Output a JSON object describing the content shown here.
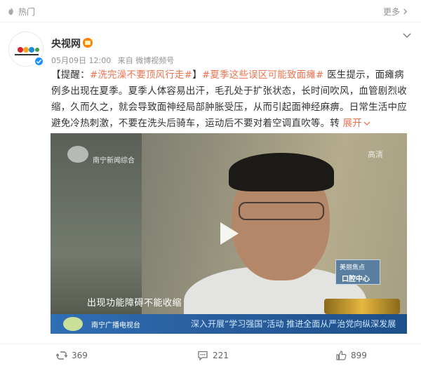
{
  "topbar": {
    "hot_label": "热门",
    "more_label": "更多"
  },
  "post": {
    "author": "央视网",
    "date": "05月09日 12:00",
    "source": "来自 微博视频号",
    "content": {
      "prefix": "【提醒：",
      "tag1": "#洗完澡不要顶风行走#",
      "mid": "】",
      "tag2": "#夏季这些误区可能致面瘫#",
      "body": " 医生提示，面瘫病例多出现在夏季。夏季人体容易出汗，毛孔处于扩张状态，长时间吹风，血管剧烈收缩，久而久之，就会导致面神经局部肿胀受压，从而引起面神经麻痹。日常生活中应避免冷热刺激，不要在洗头后骑车，运动后不要对着空调直吹等。转 ",
      "expand": "展开"
    },
    "video": {
      "station": "南宁新闻综合",
      "hd": "高清",
      "side_badge_line1": "美丽焦点",
      "side_badge_line2": "口腔中心",
      "subtitle": "出现功能障碍不能收缩",
      "channel": "南宁广播电视台",
      "ticker": "深入开展“学习强国”活动  推进全面从严治党向纵深发展"
    },
    "actions": {
      "repost_count": "369",
      "comment_count": "221",
      "like_count": "899"
    }
  },
  "colors": {
    "accent": "#eb7350",
    "verify": "#1890ff",
    "muted": "#939393"
  }
}
